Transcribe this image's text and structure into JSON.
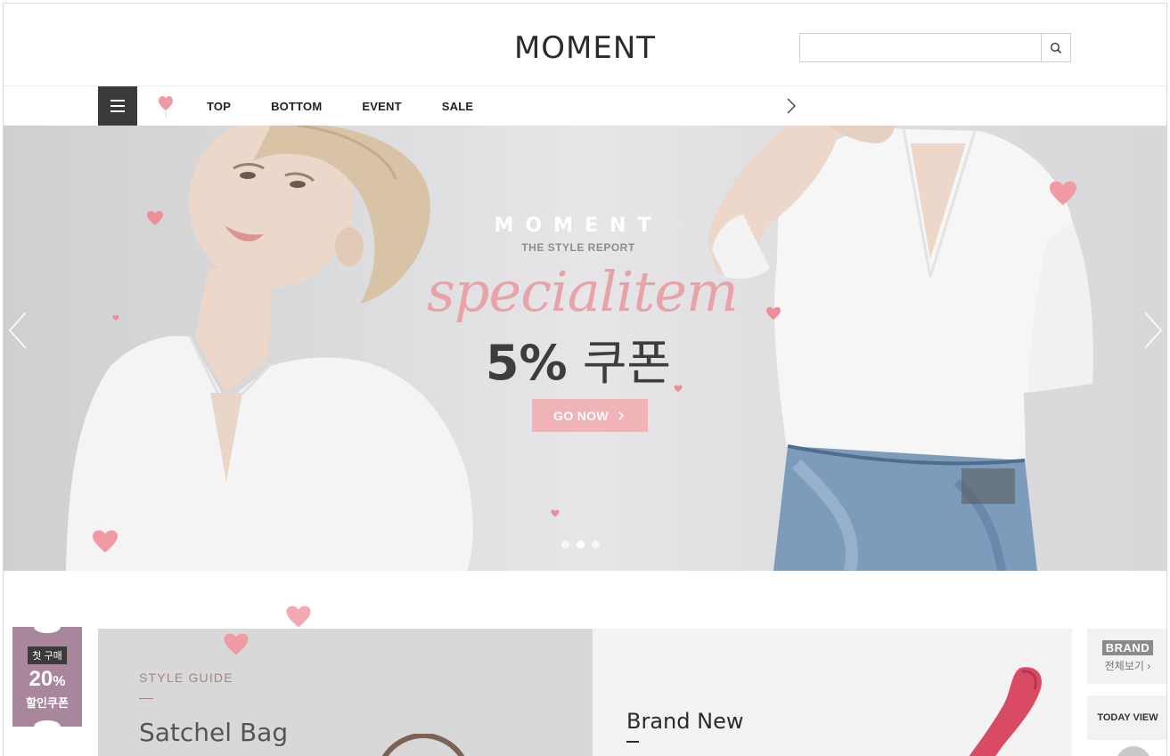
{
  "header": {
    "logo": "MOMENT",
    "search": {
      "placeholder": "",
      "icon": "search-icon"
    }
  },
  "nav": {
    "menu_icon": "hamburger-icon",
    "items": [
      {
        "label": "TOP"
      },
      {
        "label": "BOTTOM"
      },
      {
        "label": "EVENT"
      },
      {
        "label": "SALE"
      }
    ],
    "next_icon": "chevron-right-icon"
  },
  "hero": {
    "brand": "MOMENT",
    "subtitle": "THE STYLE REPORT",
    "script": "specialitem",
    "coupon_value": "5%",
    "coupon_text": "쿠폰",
    "button_label": "GO NOW",
    "slide_count": 3,
    "active_slide": 2
  },
  "coupon_badge": {
    "tag": "첫 구매",
    "percent": "20",
    "percent_sign": "%",
    "label": "할인쿠폰"
  },
  "style_guide": {
    "eyebrow": "STYLE GUIDE",
    "title": "Satchel Bag"
  },
  "brand_new": {
    "title": "Brand New"
  },
  "sidebar": {
    "brand_label": "BRAND",
    "brand_all": "전체보기",
    "today_view": "TODAY VIEW"
  },
  "colors": {
    "accent_pink": "#f0b3b8",
    "script_pink": "#e8a3a9",
    "coupon_purple": "#a8869c",
    "dark": "#3a3a3a"
  }
}
